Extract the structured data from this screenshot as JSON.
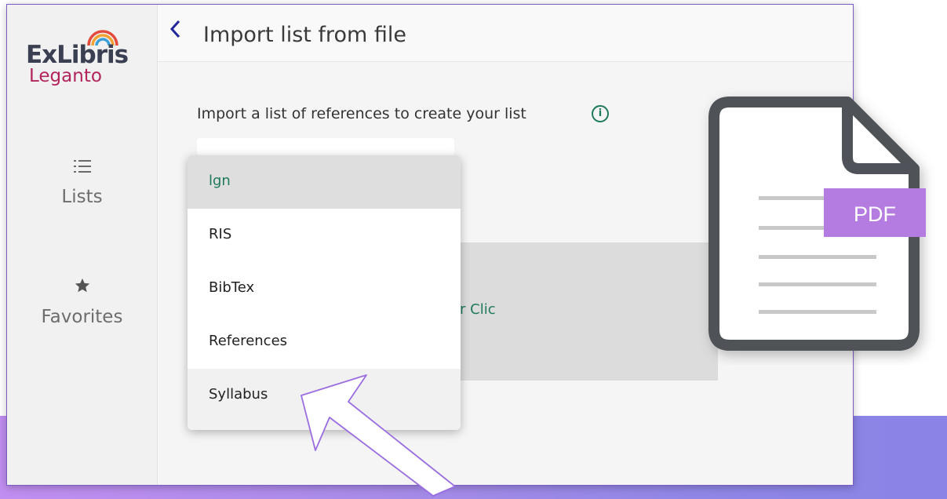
{
  "brand": {
    "name_main": "ExLibris",
    "name_sub": "Leganto"
  },
  "sidebar": {
    "items": [
      {
        "label": "Lists",
        "icon": "list-icon"
      },
      {
        "label": "Favorites",
        "icon": "star-icon"
      }
    ]
  },
  "header": {
    "title": "Import list from file",
    "back_icon": "chevron-left-icon"
  },
  "main": {
    "import_label": "Import a list of references to create your list",
    "info_icon": "info-icon",
    "dropzone_text": "r Clic"
  },
  "dropdown": {
    "options": [
      "lgn",
      "RIS",
      "BibTex",
      "References",
      "Syllabus"
    ],
    "highlighted": "lgn"
  },
  "overlay": {
    "pdf_badge": "PDF",
    "arrow_icon": "pointer-arrow-icon",
    "file_icon": "pdf-file-icon"
  },
  "colors": {
    "accent": "#1f7a5a",
    "back": "#22279a",
    "brand_red": "#b2245c",
    "pdf_badge": "#b47be0",
    "band_start": "#c08ef0",
    "band_end": "#8a84e6"
  }
}
